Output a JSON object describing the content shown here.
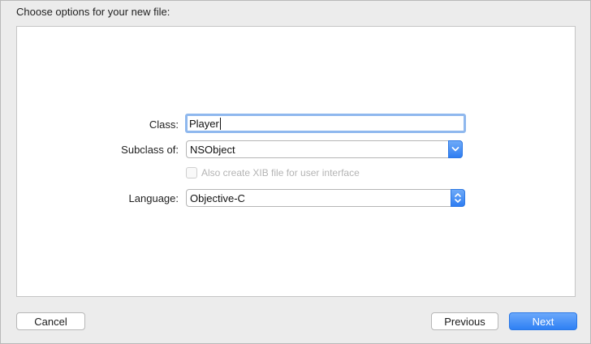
{
  "dialog": {
    "title": "Choose options for your new file:"
  },
  "form": {
    "class_label": "Class:",
    "class_value": "Player",
    "subclass_label": "Subclass of:",
    "subclass_value": "NSObject",
    "xib_checkbox_label": "Also create XIB file for user interface",
    "xib_checked": false,
    "language_label": "Language:",
    "language_value": "Objective-C"
  },
  "buttons": {
    "cancel": "Cancel",
    "previous": "Previous",
    "next": "Next"
  },
  "colors": {
    "accent": "#2e80f4",
    "focus_ring": "#8fb8ee",
    "disabled_text": "#b4b4b4"
  },
  "icons": {
    "subclass_popup": "chevron-down-icon",
    "language_popup": "up-down-chevron-icon"
  }
}
